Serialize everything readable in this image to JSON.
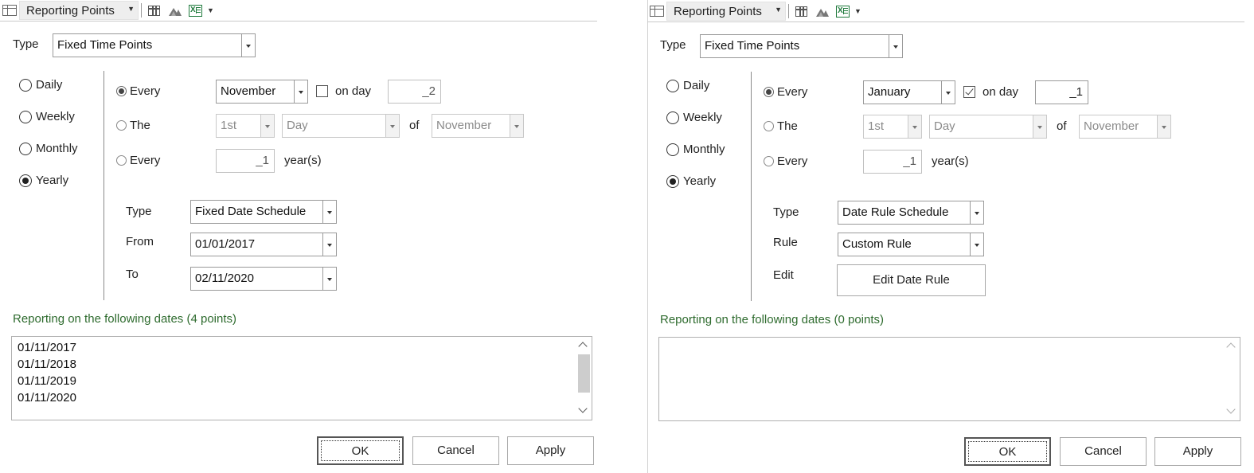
{
  "toolbar": {
    "title": "Reporting Points"
  },
  "left": {
    "type_label": "Type",
    "type_value": "Fixed Time Points",
    "freq": {
      "daily": "Daily",
      "weekly": "Weekly",
      "monthly": "Monthly",
      "yearly": "Yearly",
      "selected": "Yearly"
    },
    "every_label": "Every",
    "every_month": "November",
    "on_day_label": "on day",
    "on_day_checked": false,
    "on_day_value": "_2",
    "the_label": "The",
    "the_ordinal": "1st",
    "the_day": "Day",
    "of_label": "of",
    "the_month": "November",
    "every2_label": "Every",
    "years_value": "_1",
    "years_label": "year(s)",
    "sched_type_label": "Type",
    "sched_type_value": "Fixed Date Schedule",
    "from_label": "From",
    "from_value": "01/01/2017",
    "to_label": "To",
    "to_value": "02/11/2020",
    "reporting_label": "Reporting on the following dates (4 points)",
    "dates": [
      "01/11/2017",
      "01/11/2018",
      "01/11/2019",
      "01/11/2020"
    ],
    "buttons": {
      "ok": "OK",
      "cancel": "Cancel",
      "apply": "Apply"
    }
  },
  "right": {
    "type_label": "Type",
    "type_value": "Fixed Time Points",
    "freq": {
      "daily": "Daily",
      "weekly": "Weekly",
      "monthly": "Monthly",
      "yearly": "Yearly",
      "selected": "Yearly"
    },
    "every_label": "Every",
    "every_month": "January",
    "on_day_label": "on day",
    "on_day_checked": true,
    "on_day_value": "_1",
    "the_label": "The",
    "the_ordinal": "1st",
    "the_day": "Day",
    "of_label": "of",
    "the_month": "November",
    "every2_label": "Every",
    "years_value": "_1",
    "years_label": "year(s)",
    "sched_type_label": "Type",
    "sched_type_value": "Date Rule Schedule",
    "rule_label": "Rule",
    "rule_value": "Custom Rule",
    "edit_label": "Edit",
    "edit_button": "Edit Date Rule",
    "reporting_label": "Reporting on the following dates (0 points)",
    "dates": [],
    "buttons": {
      "ok": "OK",
      "cancel": "Cancel",
      "apply": "Apply"
    }
  }
}
